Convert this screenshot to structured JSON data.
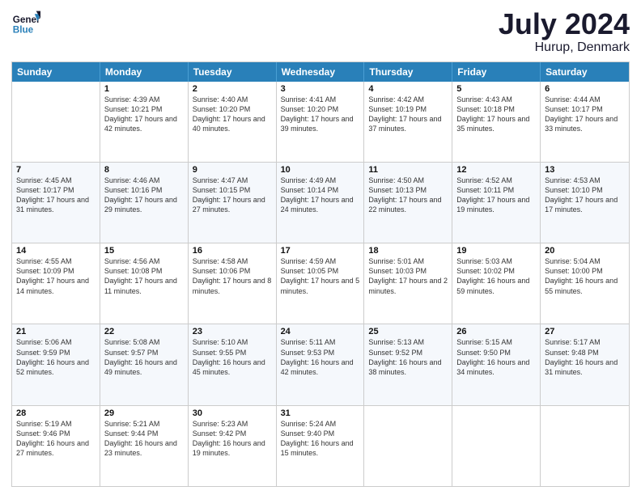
{
  "header": {
    "logo_line1": "General",
    "logo_line2": "Blue",
    "title": "July 2024",
    "location": "Hurup, Denmark"
  },
  "weekdays": [
    "Sunday",
    "Monday",
    "Tuesday",
    "Wednesday",
    "Thursday",
    "Friday",
    "Saturday"
  ],
  "rows": [
    [
      {
        "day": "",
        "sunrise": "",
        "sunset": "",
        "daylight": ""
      },
      {
        "day": "1",
        "sunrise": "Sunrise: 4:39 AM",
        "sunset": "Sunset: 10:21 PM",
        "daylight": "Daylight: 17 hours and 42 minutes."
      },
      {
        "day": "2",
        "sunrise": "Sunrise: 4:40 AM",
        "sunset": "Sunset: 10:20 PM",
        "daylight": "Daylight: 17 hours and 40 minutes."
      },
      {
        "day": "3",
        "sunrise": "Sunrise: 4:41 AM",
        "sunset": "Sunset: 10:20 PM",
        "daylight": "Daylight: 17 hours and 39 minutes."
      },
      {
        "day": "4",
        "sunrise": "Sunrise: 4:42 AM",
        "sunset": "Sunset: 10:19 PM",
        "daylight": "Daylight: 17 hours and 37 minutes."
      },
      {
        "day": "5",
        "sunrise": "Sunrise: 4:43 AM",
        "sunset": "Sunset: 10:18 PM",
        "daylight": "Daylight: 17 hours and 35 minutes."
      },
      {
        "day": "6",
        "sunrise": "Sunrise: 4:44 AM",
        "sunset": "Sunset: 10:17 PM",
        "daylight": "Daylight: 17 hours and 33 minutes."
      }
    ],
    [
      {
        "day": "7",
        "sunrise": "Sunrise: 4:45 AM",
        "sunset": "Sunset: 10:17 PM",
        "daylight": "Daylight: 17 hours and 31 minutes."
      },
      {
        "day": "8",
        "sunrise": "Sunrise: 4:46 AM",
        "sunset": "Sunset: 10:16 PM",
        "daylight": "Daylight: 17 hours and 29 minutes."
      },
      {
        "day": "9",
        "sunrise": "Sunrise: 4:47 AM",
        "sunset": "Sunset: 10:15 PM",
        "daylight": "Daylight: 17 hours and 27 minutes."
      },
      {
        "day": "10",
        "sunrise": "Sunrise: 4:49 AM",
        "sunset": "Sunset: 10:14 PM",
        "daylight": "Daylight: 17 hours and 24 minutes."
      },
      {
        "day": "11",
        "sunrise": "Sunrise: 4:50 AM",
        "sunset": "Sunset: 10:13 PM",
        "daylight": "Daylight: 17 hours and 22 minutes."
      },
      {
        "day": "12",
        "sunrise": "Sunrise: 4:52 AM",
        "sunset": "Sunset: 10:11 PM",
        "daylight": "Daylight: 17 hours and 19 minutes."
      },
      {
        "day": "13",
        "sunrise": "Sunrise: 4:53 AM",
        "sunset": "Sunset: 10:10 PM",
        "daylight": "Daylight: 17 hours and 17 minutes."
      }
    ],
    [
      {
        "day": "14",
        "sunrise": "Sunrise: 4:55 AM",
        "sunset": "Sunset: 10:09 PM",
        "daylight": "Daylight: 17 hours and 14 minutes."
      },
      {
        "day": "15",
        "sunrise": "Sunrise: 4:56 AM",
        "sunset": "Sunset: 10:08 PM",
        "daylight": "Daylight: 17 hours and 11 minutes."
      },
      {
        "day": "16",
        "sunrise": "Sunrise: 4:58 AM",
        "sunset": "Sunset: 10:06 PM",
        "daylight": "Daylight: 17 hours and 8 minutes."
      },
      {
        "day": "17",
        "sunrise": "Sunrise: 4:59 AM",
        "sunset": "Sunset: 10:05 PM",
        "daylight": "Daylight: 17 hours and 5 minutes."
      },
      {
        "day": "18",
        "sunrise": "Sunrise: 5:01 AM",
        "sunset": "Sunset: 10:03 PM",
        "daylight": "Daylight: 17 hours and 2 minutes."
      },
      {
        "day": "19",
        "sunrise": "Sunrise: 5:03 AM",
        "sunset": "Sunset: 10:02 PM",
        "daylight": "Daylight: 16 hours and 59 minutes."
      },
      {
        "day": "20",
        "sunrise": "Sunrise: 5:04 AM",
        "sunset": "Sunset: 10:00 PM",
        "daylight": "Daylight: 16 hours and 55 minutes."
      }
    ],
    [
      {
        "day": "21",
        "sunrise": "Sunrise: 5:06 AM",
        "sunset": "Sunset: 9:59 PM",
        "daylight": "Daylight: 16 hours and 52 minutes."
      },
      {
        "day": "22",
        "sunrise": "Sunrise: 5:08 AM",
        "sunset": "Sunset: 9:57 PM",
        "daylight": "Daylight: 16 hours and 49 minutes."
      },
      {
        "day": "23",
        "sunrise": "Sunrise: 5:10 AM",
        "sunset": "Sunset: 9:55 PM",
        "daylight": "Daylight: 16 hours and 45 minutes."
      },
      {
        "day": "24",
        "sunrise": "Sunrise: 5:11 AM",
        "sunset": "Sunset: 9:53 PM",
        "daylight": "Daylight: 16 hours and 42 minutes."
      },
      {
        "day": "25",
        "sunrise": "Sunrise: 5:13 AM",
        "sunset": "Sunset: 9:52 PM",
        "daylight": "Daylight: 16 hours and 38 minutes."
      },
      {
        "day": "26",
        "sunrise": "Sunrise: 5:15 AM",
        "sunset": "Sunset: 9:50 PM",
        "daylight": "Daylight: 16 hours and 34 minutes."
      },
      {
        "day": "27",
        "sunrise": "Sunrise: 5:17 AM",
        "sunset": "Sunset: 9:48 PM",
        "daylight": "Daylight: 16 hours and 31 minutes."
      }
    ],
    [
      {
        "day": "28",
        "sunrise": "Sunrise: 5:19 AM",
        "sunset": "Sunset: 9:46 PM",
        "daylight": "Daylight: 16 hours and 27 minutes."
      },
      {
        "day": "29",
        "sunrise": "Sunrise: 5:21 AM",
        "sunset": "Sunset: 9:44 PM",
        "daylight": "Daylight: 16 hours and 23 minutes."
      },
      {
        "day": "30",
        "sunrise": "Sunrise: 5:23 AM",
        "sunset": "Sunset: 9:42 PM",
        "daylight": "Daylight: 16 hours and 19 minutes."
      },
      {
        "day": "31",
        "sunrise": "Sunrise: 5:24 AM",
        "sunset": "Sunset: 9:40 PM",
        "daylight": "Daylight: 16 hours and 15 minutes."
      },
      {
        "day": "",
        "sunrise": "",
        "sunset": "",
        "daylight": ""
      },
      {
        "day": "",
        "sunrise": "",
        "sunset": "",
        "daylight": ""
      },
      {
        "day": "",
        "sunrise": "",
        "sunset": "",
        "daylight": ""
      }
    ]
  ]
}
